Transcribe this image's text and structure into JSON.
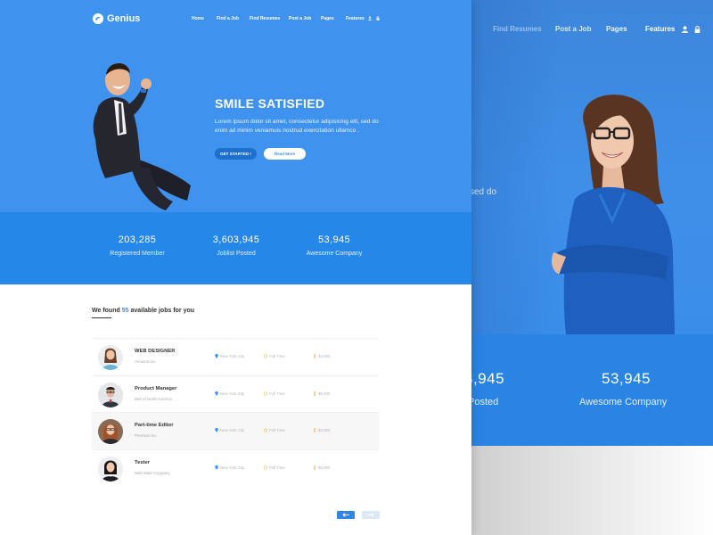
{
  "brand": {
    "name": "Genius",
    "logo_icon": "genius-logo-icon"
  },
  "nav": {
    "items": [
      "Home",
      "Find a Job",
      "Find Resumes",
      "Post a Job",
      "Pages",
      "Features"
    ],
    "icons": [
      "user-icon",
      "lock-icon"
    ]
  },
  "hero": {
    "title": "SMILE SATISFIED",
    "description": "Lorem ipsum dolor sit amet, consectetur adipisicing elit, sed do enim ad minim veniamuis nostrud exercitation ullamco .",
    "primary_button": "GET STARTED !",
    "secondary_button": "Read More"
  },
  "stats": [
    {
      "value": "203,285",
      "label": "Registered Member"
    },
    {
      "value": "3,603,945",
      "label": "Joblist Posted"
    },
    {
      "value": "53,945",
      "label": "Awesome Company"
    }
  ],
  "jobs_heading": {
    "prefix": "We found",
    "count": "95",
    "suffix": "available jobs for you"
  },
  "jobs": [
    {
      "title": "WEB DESIGNER",
      "company": "Amazon Inc.",
      "location": "New York City",
      "type": "Full Time",
      "salary": "$4,000"
    },
    {
      "title": "Product Manager",
      "company": "IBM of North America",
      "location": "New York City",
      "type": "Full Time",
      "salary": "$5,000"
    },
    {
      "title": "Part-time Editor",
      "company": "Premium Inc.",
      "location": "New York City",
      "type": "Full Time",
      "salary": "$3,000"
    },
    {
      "title": "Tester",
      "company": "Wild Wast Company",
      "location": "New York City",
      "type": "Full Time",
      "salary": "$6,000"
    }
  ],
  "pagination": {
    "prev_icon": "arrow-left-icon",
    "next_icon": "arrow-right-icon"
  },
  "background_view": {
    "nav_items": [
      "Find Resumes",
      "Post a Job",
      "Pages",
      "Features"
    ],
    "partial_text": "sed do",
    "stats": [
      {
        "value": "3,945",
        "label": "Posted"
      },
      {
        "value": "53,945",
        "label": "Awesome Company"
      }
    ]
  },
  "colors": {
    "primary": "#3f93ee",
    "stats_band": "#2587e8",
    "button_dark": "#1f6fcf",
    "accent_count": "#3f93ee"
  }
}
